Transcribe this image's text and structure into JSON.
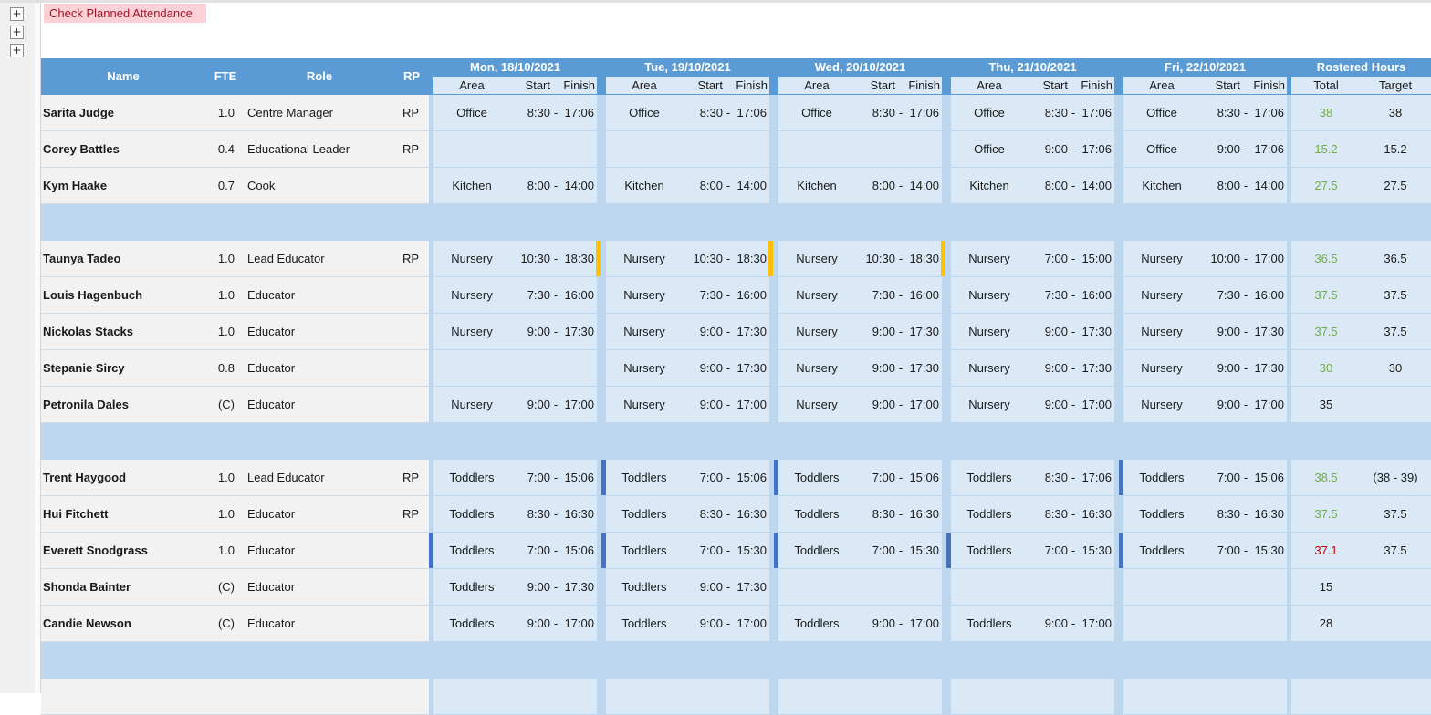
{
  "toolbar": {
    "check_label": "Check Planned Attendance",
    "expand_icons": [
      "plus-icon",
      "plus-icon",
      "plus-icon"
    ]
  },
  "header": {
    "name": "Name",
    "fte": "FTE",
    "role": "Role",
    "rp": "RP",
    "days": [
      "Mon, 18/10/2021",
      "Tue, 19/10/2021",
      "Wed, 20/10/2021",
      "Thu, 21/10/2021",
      "Fri, 22/10/2021"
    ],
    "area": "Area",
    "start": "Start",
    "finish": "Finish",
    "rostered": "Rostered Hours",
    "total": "Total",
    "target": "Target"
  },
  "colors": {
    "header_blue": "#5b9bd5",
    "cell_light": "#dbe9f7",
    "band": "#bdd7ee",
    "ok_green": "#70ad47",
    "bad_red": "#c00000",
    "check_pink": "#fbd0d6"
  },
  "rows": [
    {
      "name": "Sarita Judge",
      "fte": "1.0",
      "role": "Centre Manager",
      "rp": "RP",
      "days": [
        [
          "Office",
          "8:30",
          "17:06"
        ],
        [
          "Office",
          "8:30",
          "17:06"
        ],
        [
          "Office",
          "8:30",
          "17:06"
        ],
        [
          "Office",
          "8:30",
          "17:06"
        ],
        [
          "Office",
          "8:30",
          "17:06"
        ]
      ],
      "total": "38",
      "target": "38",
      "status": "ok"
    },
    {
      "name": "Corey Battles",
      "fte": "0.4",
      "role": "Educational Leader",
      "rp": "RP",
      "days": [
        null,
        null,
        null,
        [
          "Office",
          "9:00",
          "17:06"
        ],
        [
          "Office",
          "9:00",
          "17:06"
        ]
      ],
      "total": "15.2",
      "target": "15.2",
      "status": "ok"
    },
    {
      "name": "Kym Haake",
      "fte": "0.7",
      "role": "Cook",
      "rp": "",
      "days": [
        [
          "Kitchen",
          "8:00",
          "14:00"
        ],
        [
          "Kitchen",
          "8:00",
          "14:00"
        ],
        [
          "Kitchen",
          "8:00",
          "14:00"
        ],
        [
          "Kitchen",
          "8:00",
          "14:00"
        ],
        [
          "Kitchen",
          "8:00",
          "14:00"
        ]
      ],
      "total": "27.5",
      "target": "27.5",
      "status": "ok"
    },
    {
      "band": true
    },
    {
      "name": "Taunya Tadeo",
      "fte": "1.0",
      "role": "Lead Educator",
      "rp": "RP",
      "days": [
        [
          "Nursery",
          "10:30",
          "18:30",
          "y"
        ],
        [
          "Nursery",
          "10:30",
          "18:30",
          "y"
        ],
        [
          "Nursery",
          "10:30",
          "18:30",
          "y"
        ],
        [
          "Nursery",
          "7:00",
          "15:00"
        ],
        [
          "Nursery",
          "10:00",
          "17:00"
        ]
      ],
      "total": "36.5",
      "target": "36.5",
      "status": "ok"
    },
    {
      "name": "Louis Hagenbuch",
      "fte": "1.0",
      "role": "Educator",
      "rp": "",
      "days": [
        [
          "Nursery",
          "7:30",
          "16:00"
        ],
        [
          "Nursery",
          "7:30",
          "16:00"
        ],
        [
          "Nursery",
          "7:30",
          "16:00"
        ],
        [
          "Nursery",
          "7:30",
          "16:00"
        ],
        [
          "Nursery",
          "7:30",
          "16:00"
        ]
      ],
      "total": "37.5",
      "target": "37.5",
      "status": "ok"
    },
    {
      "name": "Nickolas Stacks",
      "fte": "1.0",
      "role": "Educator",
      "rp": "",
      "days": [
        [
          "Nursery",
          "9:00",
          "17:30"
        ],
        [
          "Nursery",
          "9:00",
          "17:30"
        ],
        [
          "Nursery",
          "9:00",
          "17:30"
        ],
        [
          "Nursery",
          "9:00",
          "17:30"
        ],
        [
          "Nursery",
          "9:00",
          "17:30"
        ]
      ],
      "total": "37.5",
      "target": "37.5",
      "status": "ok"
    },
    {
      "name": "Stepanie Sircy",
      "fte": "0.8",
      "role": "Educator",
      "rp": "",
      "days": [
        null,
        [
          "Nursery",
          "9:00",
          "17:30"
        ],
        [
          "Nursery",
          "9:00",
          "17:30"
        ],
        [
          "Nursery",
          "9:00",
          "17:30"
        ],
        [
          "Nursery",
          "9:00",
          "17:30"
        ]
      ],
      "total": "30",
      "target": "30",
      "status": "ok"
    },
    {
      "name": "Petronila Dales",
      "fte": "(C)",
      "role": "Educator",
      "rp": "",
      "days": [
        [
          "Nursery",
          "9:00",
          "17:00"
        ],
        [
          "Nursery",
          "9:00",
          "17:00"
        ],
        [
          "Nursery",
          "9:00",
          "17:00"
        ],
        [
          "Nursery",
          "9:00",
          "17:00"
        ],
        [
          "Nursery",
          "9:00",
          "17:00"
        ]
      ],
      "total": "35",
      "target": "",
      "status": "none"
    },
    {
      "band": true
    },
    {
      "name": "Trent Haygood",
      "fte": "1.0",
      "role": "Lead Educator",
      "rp": "RP",
      "days": [
        [
          "Toddlers",
          "7:00",
          "15:06"
        ],
        [
          "Toddlers",
          "7:00",
          "15:06",
          "b"
        ],
        [
          "Toddlers",
          "7:00",
          "15:06",
          "b"
        ],
        [
          "Toddlers",
          "8:30",
          "17:06"
        ],
        [
          "Toddlers",
          "7:00",
          "15:06",
          "b"
        ]
      ],
      "total": "38.5",
      "target": "(38 - 39)",
      "status": "ok"
    },
    {
      "name": "Hui Fitchett",
      "fte": "1.0",
      "role": "Educator",
      "rp": "RP",
      "days": [
        [
          "Toddlers",
          "8:30",
          "16:30"
        ],
        [
          "Toddlers",
          "8:30",
          "16:30"
        ],
        [
          "Toddlers",
          "8:30",
          "16:30"
        ],
        [
          "Toddlers",
          "8:30",
          "16:30"
        ],
        [
          "Toddlers",
          "8:30",
          "16:30"
        ]
      ],
      "total": "37.5",
      "target": "37.5",
      "status": "ok"
    },
    {
      "name": "Everett Snodgrass",
      "fte": "1.0",
      "role": "Educator",
      "rp": "",
      "days": [
        [
          "Toddlers",
          "7:00",
          "15:06",
          "b"
        ],
        [
          "Toddlers",
          "7:00",
          "15:30",
          "b"
        ],
        [
          "Toddlers",
          "7:00",
          "15:30",
          "b"
        ],
        [
          "Toddlers",
          "7:00",
          "15:30",
          "b"
        ],
        [
          "Toddlers",
          "7:00",
          "15:30",
          "b"
        ]
      ],
      "total": "37.1",
      "target": "37.5",
      "status": "bad"
    },
    {
      "name": "Shonda Bainter",
      "fte": "(C)",
      "role": "Educator",
      "rp": "",
      "days": [
        [
          "Toddlers",
          "9:00",
          "17:30"
        ],
        [
          "Toddlers",
          "9:00",
          "17:30"
        ],
        null,
        null,
        null
      ],
      "total": "15",
      "target": "",
      "status": "none"
    },
    {
      "name": "Candie Newson",
      "fte": "(C)",
      "role": "Educator",
      "rp": "",
      "days": [
        [
          "Toddlers",
          "9:00",
          "17:00"
        ],
        [
          "Toddlers",
          "9:00",
          "17:00"
        ],
        [
          "Toddlers",
          "9:00",
          "17:00"
        ],
        [
          "Toddlers",
          "9:00",
          "17:00"
        ],
        null
      ],
      "total": "28",
      "target": "",
      "status": "none"
    },
    {
      "band": true
    }
  ]
}
